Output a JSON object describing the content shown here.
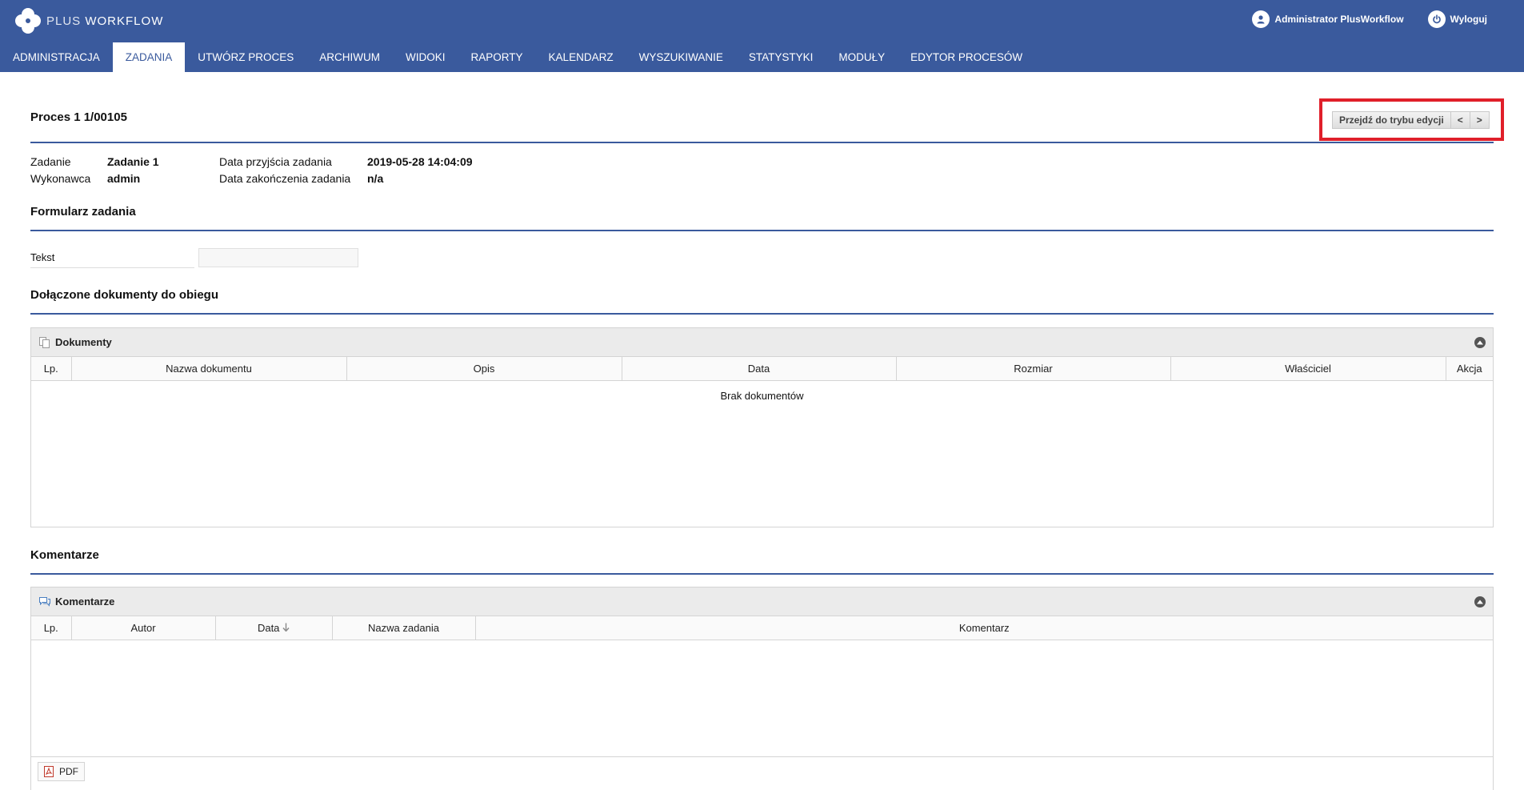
{
  "header": {
    "logo_part1": "PLUS",
    "logo_part2": "WORKFLOW",
    "user_name": "Administrator PlusWorkflow",
    "logout_label": "Wyloguj"
  },
  "nav": {
    "items": [
      "ADMINISTRACJA",
      "ZADANIA",
      "UTWÓRZ PROCES",
      "ARCHIWUM",
      "WIDOKI",
      "RAPORTY",
      "KALENDARZ",
      "WYSZUKIWANIE",
      "STATYSTYKI",
      "MODUŁY",
      "EDYTOR PROCESÓW"
    ],
    "active": "ZADANIA"
  },
  "process": {
    "title": "Proces 1 1/00105",
    "edit_button": "Przejdź do trybu edycji",
    "prev_button": "<",
    "next_button": ">"
  },
  "task_info": {
    "task_label": "Zadanie",
    "task_value": "Zadanie 1",
    "assignee_label": "Wykonawca",
    "assignee_value": "admin",
    "received_label": "Data przyjścia zadania",
    "received_value": "2019-05-28 14:04:09",
    "finished_label": "Data zakończenia zadania",
    "finished_value": "n/a"
  },
  "form": {
    "section_title": "Formularz zadania",
    "field_label": "Tekst",
    "field_value": ""
  },
  "documents": {
    "section_title": "Dołączone dokumenty do obiegu",
    "panel_title": "Dokumenty",
    "columns": [
      "Lp.",
      "Nazwa dokumentu",
      "Opis",
      "Data",
      "Rozmiar",
      "Właściciel",
      "Akcja"
    ],
    "empty_text": "Brak dokumentów"
  },
  "comments": {
    "section_title": "Komentarze",
    "panel_title": "Komentarze",
    "columns": [
      "Lp.",
      "Autor",
      "Data",
      "Nazwa zadania",
      "Komentarz"
    ],
    "sorted_column": "Data",
    "pdf_label": "PDF"
  },
  "colors": {
    "brand": "#3a5a9d",
    "highlight": "#e01f2a"
  }
}
